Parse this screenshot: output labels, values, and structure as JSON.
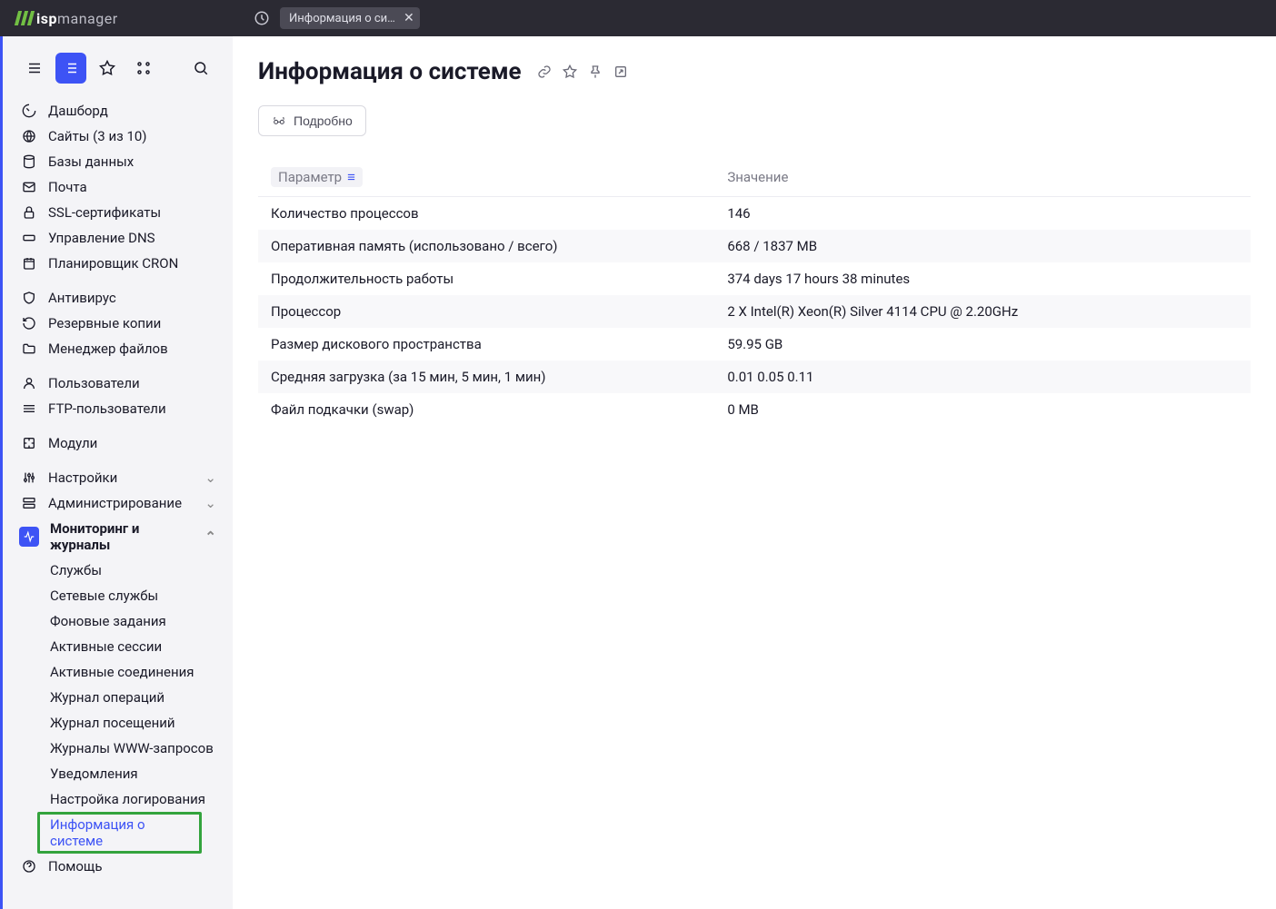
{
  "brand": {
    "bold": "isp",
    "light": "manager"
  },
  "tab": {
    "label": "Информация о сис..."
  },
  "sidebar": {
    "items": [
      {
        "label": "Дашборд"
      },
      {
        "label": "Сайты (3 из 10)"
      },
      {
        "label": "Базы данных"
      },
      {
        "label": "Почта"
      },
      {
        "label": "SSL-сертификаты"
      },
      {
        "label": "Управление DNS"
      },
      {
        "label": "Планировщик CRON"
      },
      {
        "label": "Антивирус"
      },
      {
        "label": "Резервные копии"
      },
      {
        "label": "Менеджер файлов"
      },
      {
        "label": "Пользователи"
      },
      {
        "label": "FTP-пользователи"
      },
      {
        "label": "Модули"
      },
      {
        "label": "Настройки"
      },
      {
        "label": "Администрирование"
      },
      {
        "label": "Мониторинг и журналы"
      },
      {
        "label": "Помощь"
      }
    ],
    "submenu": [
      {
        "label": "Службы"
      },
      {
        "label": "Сетевые службы"
      },
      {
        "label": "Фоновые задания"
      },
      {
        "label": "Активные сессии"
      },
      {
        "label": "Активные соединения"
      },
      {
        "label": "Журнал операций"
      },
      {
        "label": "Журнал посещений"
      },
      {
        "label": "Журналы WWW-запросов"
      },
      {
        "label": "Уведомления"
      },
      {
        "label": "Настройка логирования"
      },
      {
        "label": "Информация о системе"
      }
    ]
  },
  "page": {
    "title": "Информация о системе",
    "detail_label": "Подробно",
    "columns": {
      "param": "Параметр",
      "value": "Значение"
    },
    "rows": [
      {
        "param": "Количество процессов",
        "value": "146"
      },
      {
        "param": "Оперативная память (использовано / всего)",
        "value": "668 / 1837 MB"
      },
      {
        "param": "Продолжительность работы",
        "value": "374 days 17 hours 38 minutes"
      },
      {
        "param": "Процессор",
        "value": "2 X Intel(R) Xeon(R) Silver 4114 CPU @ 2.20GHz"
      },
      {
        "param": "Размер дискового пространства",
        "value": "59.95 GB"
      },
      {
        "param": "Средняя загрузка (за 15 мин, 5 мин, 1 мин)",
        "value": "0.01 0.05 0.11"
      },
      {
        "param": "Файл подкачки (swap)",
        "value": "0 MB"
      }
    ]
  }
}
